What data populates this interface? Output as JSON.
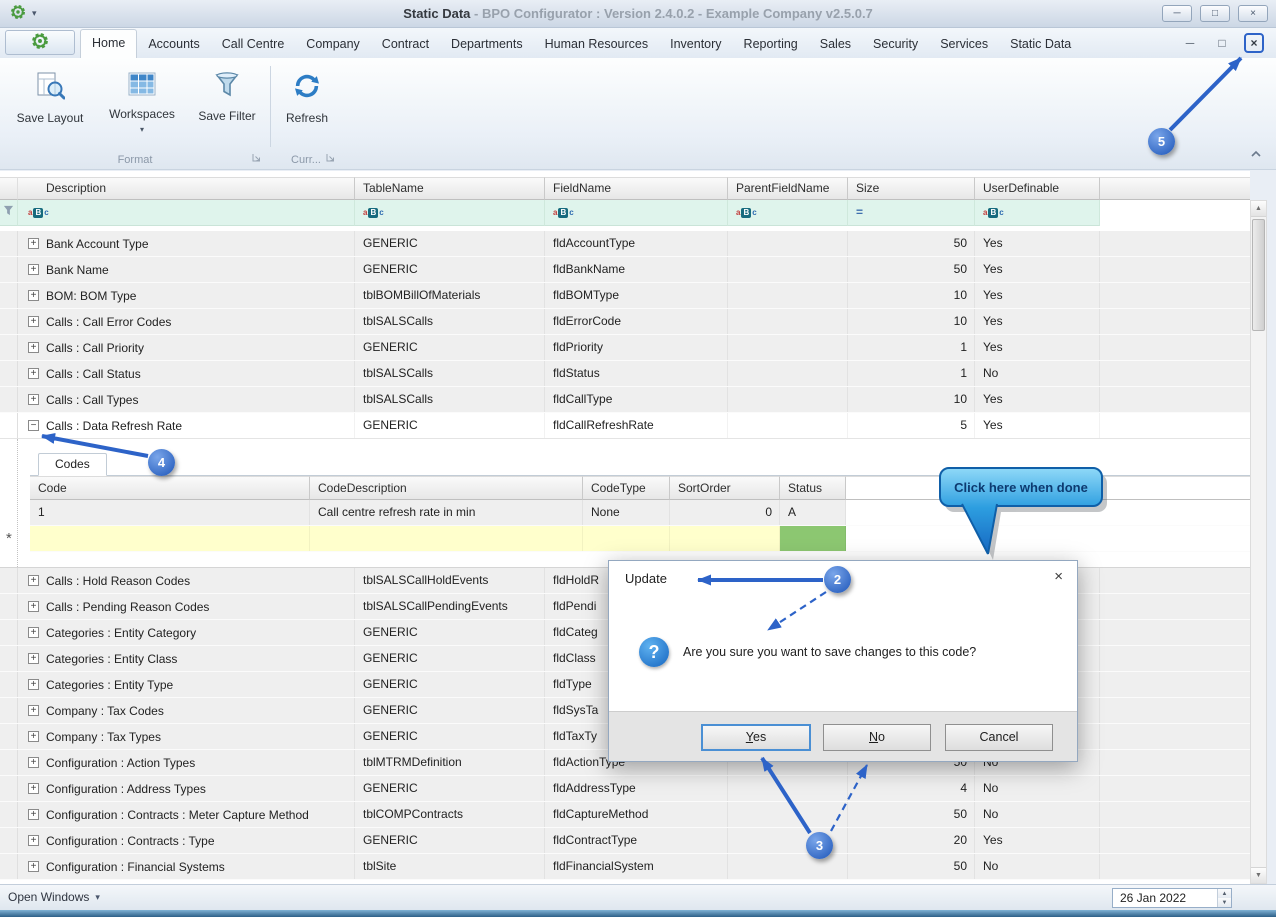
{
  "window": {
    "title_app": "Static Data",
    "title_rest": " - BPO Configurator : Version 2.4.0.2 - Example Company v2.5.0.7"
  },
  "icons": {
    "minimize": "─",
    "maximize": "□",
    "restore": "□",
    "close": "×",
    "dropdown": "▾",
    "expand": "+",
    "collapse": "−",
    "scroll_up": "▲",
    "scroll_down": "▼",
    "spin_up": "▲",
    "spin_down": "▼",
    "abc_a": "a",
    "abc_b": "B",
    "abc_c": "c",
    "equals_operator": "=",
    "new_row_marker": "*",
    "question_mark": "?"
  },
  "ribbon": {
    "selected_tab": "Home",
    "tabs": [
      "Home",
      "Accounts",
      "Call Centre",
      "Company",
      "Contract",
      "Departments",
      "Human Resources",
      "Inventory",
      "Reporting",
      "Sales",
      "Security",
      "Services",
      "Static Data"
    ],
    "buttons": {
      "save_layout": "Save Layout",
      "workspaces": "Workspaces",
      "save_filter": "Save Filter",
      "refresh": "Refresh"
    },
    "groups": {
      "format": "Format",
      "current": "Curr..."
    }
  },
  "grid": {
    "columns": [
      "Description",
      "TableName",
      "FieldName",
      "ParentFieldName",
      "Size",
      "UserDefinable"
    ],
    "rows_top": [
      {
        "description": "Bank Account Type",
        "table": "GENERIC",
        "field": "fldAccountType",
        "parent": "",
        "size": "50",
        "userdef": "Yes"
      },
      {
        "description": "Bank Name",
        "table": "GENERIC",
        "field": "fldBankName",
        "parent": "",
        "size": "50",
        "userdef": "Yes"
      },
      {
        "description": "BOM: BOM Type",
        "table": "tblBOMBillOfMaterials",
        "field": "fldBOMType",
        "parent": "",
        "size": "10",
        "userdef": "Yes"
      },
      {
        "description": "Calls : Call Error Codes",
        "table": "tblSALSCalls",
        "field": "fldErrorCode",
        "parent": "",
        "size": "10",
        "userdef": "Yes"
      },
      {
        "description": "Calls : Call Priority",
        "table": "GENERIC",
        "field": "fldPriority",
        "parent": "",
        "size": "1",
        "userdef": "Yes"
      },
      {
        "description": "Calls : Call Status",
        "table": "tblSALSCalls",
        "field": "fldStatus",
        "parent": "",
        "size": "1",
        "userdef": "No"
      },
      {
        "description": "Calls : Call Types",
        "table": "tblSALSCalls",
        "field": "fldCallType",
        "parent": "",
        "size": "10",
        "userdef": "Yes"
      },
      {
        "description": "Calls : Data Refresh Rate",
        "table": "GENERIC",
        "field": "fldCallRefreshRate",
        "parent": "",
        "size": "5",
        "userdef": "Yes",
        "expanded": true
      }
    ],
    "rows_bottom": [
      {
        "description": "Calls : Hold Reason Codes",
        "table": "tblSALSCallHoldEvents",
        "field": "fldHoldR",
        "parent": "",
        "size": "",
        "userdef": ""
      },
      {
        "description": "Calls : Pending Reason Codes",
        "table": "tblSALSCallPendingEvents",
        "field": "fldPendi",
        "parent": "",
        "size": "",
        "userdef": ""
      },
      {
        "description": "Categories : Entity Category",
        "table": "GENERIC",
        "field": "fldCateg",
        "parent": "",
        "size": "",
        "userdef": ""
      },
      {
        "description": "Categories : Entity Class",
        "table": "GENERIC",
        "field": "fldClass",
        "parent": "",
        "size": "",
        "userdef": ""
      },
      {
        "description": "Categories : Entity Type",
        "table": "GENERIC",
        "field": "fldType",
        "parent": "",
        "size": "",
        "userdef": ""
      },
      {
        "description": "Company : Tax Codes",
        "table": "GENERIC",
        "field": "fldSysTa",
        "parent": "",
        "size": "",
        "userdef": ""
      },
      {
        "description": "Company : Tax Types",
        "table": "GENERIC",
        "field": "fldTaxTy",
        "parent": "",
        "size": "",
        "userdef": ""
      },
      {
        "description": "Configuration : Action Types",
        "table": "tblMTRMDefinition",
        "field": "fldActionType",
        "parent": "",
        "size": "50",
        "userdef": "No"
      },
      {
        "description": "Configuration : Address Types",
        "table": "GENERIC",
        "field": "fldAddressType",
        "parent": "",
        "size": "4",
        "userdef": "No"
      },
      {
        "description": "Configuration : Contracts : Meter Capture Method",
        "table": "tblCOMPContracts",
        "field": "fldCaptureMethod",
        "parent": "",
        "size": "50",
        "userdef": "No"
      },
      {
        "description": "Configuration : Contracts : Type",
        "table": "GENERIC",
        "field": "fldContractType",
        "parent": "",
        "size": "20",
        "userdef": "Yes"
      },
      {
        "description": "Configuration : Financial Systems",
        "table": "tblSite",
        "field": "fldFinancialSystem",
        "parent": "",
        "size": "50",
        "userdef": "No"
      }
    ],
    "detail": {
      "tab_label": "Codes",
      "columns": [
        "Code",
        "CodeDescription",
        "CodeType",
        "SortOrder",
        "Status"
      ],
      "rows": [
        {
          "code": "1",
          "code_description": "Call centre refresh rate in min",
          "code_type": "None",
          "sort_order": "0",
          "status": "A"
        }
      ]
    }
  },
  "dialog": {
    "title": "Update",
    "message": "Are you sure you want to save changes to this code?",
    "yes_mnemonic": "Y",
    "yes_rest": "es",
    "no_mnemonic": "N",
    "no_rest": "o",
    "cancel_label": "Cancel"
  },
  "annotations": {
    "callout_text": "Click here when done",
    "step2": "2",
    "step3": "3",
    "step4": "4",
    "step5": "5"
  },
  "statusbar": {
    "open_windows_label": "Open Windows",
    "date_value": "26 Jan 2022"
  }
}
